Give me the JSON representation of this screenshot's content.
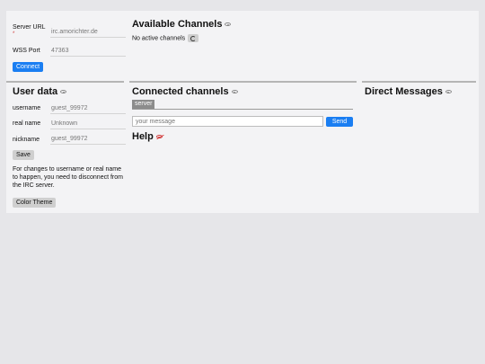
{
  "server": {
    "url_label": "Server URL",
    "url_required_marker": "*",
    "url_value": "irc.amorichter.de",
    "port_label": "WSS Port",
    "port_value": "47363",
    "connect_label": "Connect"
  },
  "channels": {
    "title": "Available Channels",
    "status": "No active channels"
  },
  "user": {
    "title": "User data",
    "username_label": "username",
    "username_value": "guest_99972",
    "realname_label": "real name",
    "realname_placeholder": "Unknown",
    "nickname_label": "nickname",
    "nickname_value": "guest_99972",
    "save_label": "Save",
    "note": "For changes to username or real name to happen, you need to disconnect from the IRC server.",
    "theme_label": "Color Theme"
  },
  "connected": {
    "title": "Connected channels",
    "tab_label": "server",
    "message_placeholder": "your message",
    "send_label": "Send"
  },
  "help": {
    "title": "Help"
  },
  "dm": {
    "title": "Direct Messages"
  },
  "colors": {
    "accent": "#1a7ef2",
    "danger": "#d23a3a",
    "panel": "#f3f3f5",
    "background": "#e6e6e9"
  },
  "icons": {
    "eye": "eye-icon",
    "eye_off": "eye-off-icon",
    "refresh": "refresh-icon"
  }
}
